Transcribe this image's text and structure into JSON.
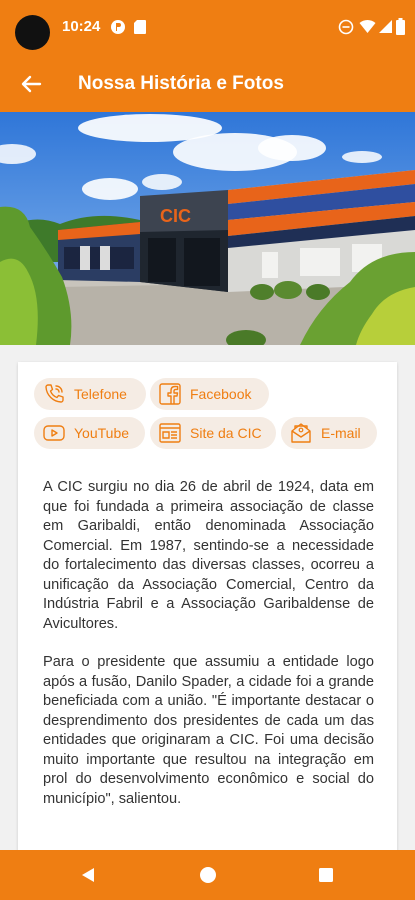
{
  "status_bar": {
    "time": "10:24"
  },
  "app_bar": {
    "title": "Nossa História e Fotos"
  },
  "hero": {
    "sign_text": "CIC"
  },
  "contacts": {
    "phone": "Telefone",
    "facebook": "Facebook",
    "youtube": "YouTube",
    "website": "Site da CIC",
    "email": "E-mail"
  },
  "history": {
    "paragraph_1": "A CIC surgiu no dia 26 de abril de 1924, data em que foi fundada a primeira associação de classe em Garibaldi, então denominada Associação Comercial. Em 1987, sentindo-se a necessidade do fortalecimento das diversas classes, ocorreu a unificação da Associação Comercial, Centro da Indústria Fabril e a Associação Garibaldense de Avicultores.",
    "paragraph_2": "Para o presidente que assumiu a entidade logo após a fusão, Danilo Spader, a cidade foi a grande beneficiada com a união. \"É importante destacar o desprendimento dos presidentes de cada um das entidades que originaram a CIC. Foi uma decisão muito importante que resultou na integração em prol do desenvolvimento econômico e social do município\", salientou."
  },
  "colors": {
    "primary": "#ef7e12",
    "chip_bg": "#f5ece4",
    "text": "#333333"
  },
  "icons": {
    "back": "arrow-back-icon",
    "phone": "phone-icon",
    "facebook": "facebook-icon",
    "youtube": "youtube-icon",
    "website": "website-icon",
    "email": "email-icon"
  }
}
